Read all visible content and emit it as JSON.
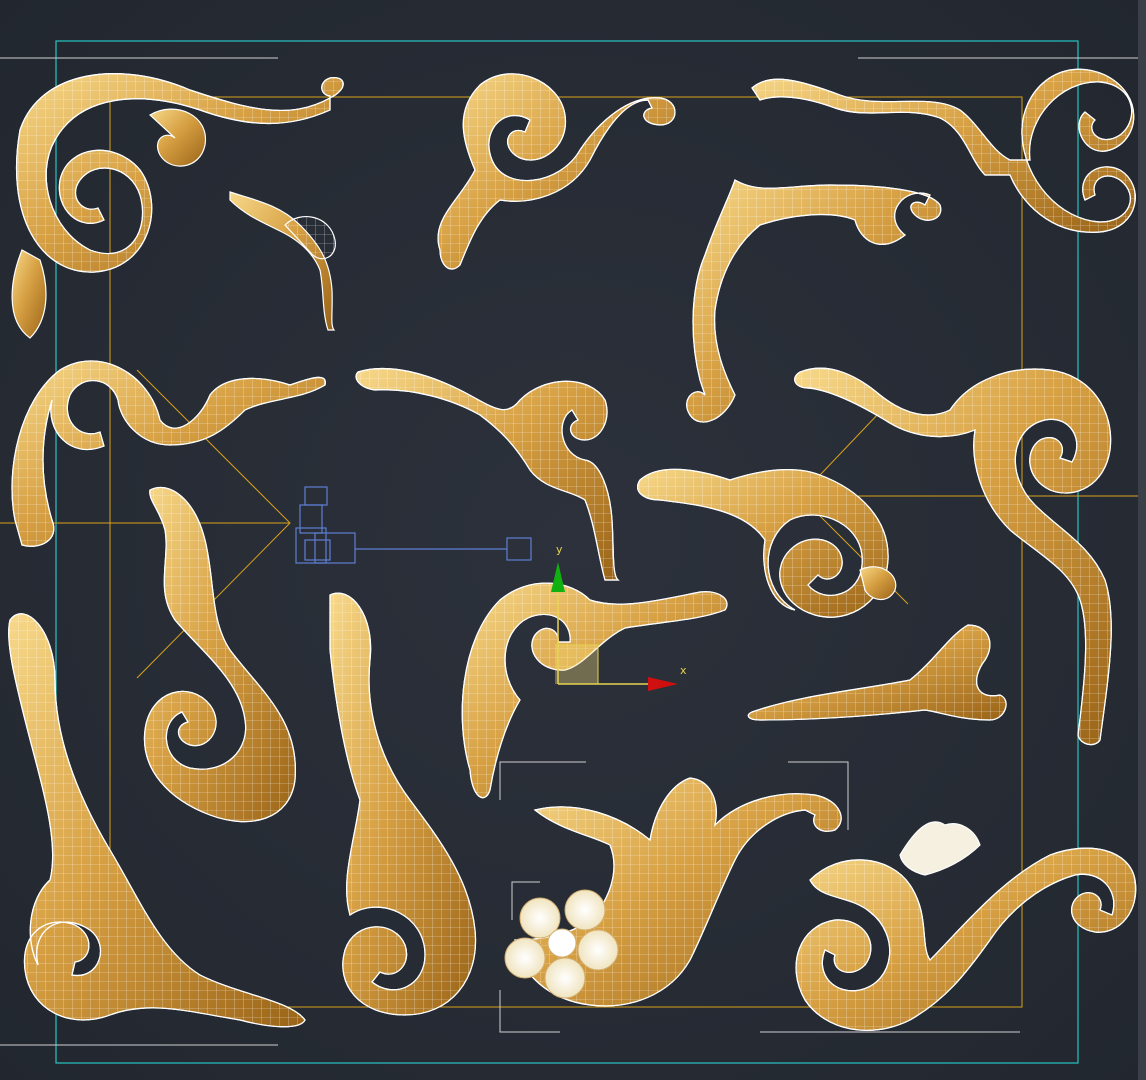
{
  "viewport": {
    "background": "#262b34",
    "safe_frame_color": "#27c4c4",
    "region_frame_color": "#d9a21a",
    "ornament_fill": "#d7a043",
    "ornament_highlight": "#f7d98a",
    "wire_color": "#ffffff",
    "camera_color": "#5d7fd3"
  },
  "gizmo": {
    "x_label": "x",
    "y_label": "y",
    "x_color": "#d01010",
    "y_color": "#10b010",
    "label_color": "#e8d250"
  }
}
